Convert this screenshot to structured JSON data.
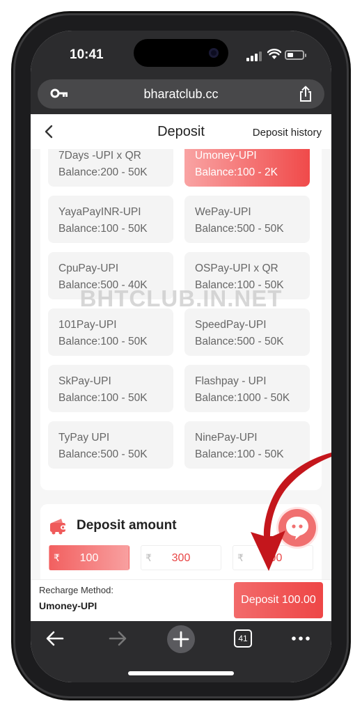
{
  "status": {
    "time": "10:41"
  },
  "browser": {
    "url": "bharatclub.cc",
    "tab_count": "41"
  },
  "header": {
    "title": "Deposit",
    "history": "Deposit history"
  },
  "channels": [
    {
      "name": "7Days -UPI x QR",
      "balance": "Balance:200 - 50K",
      "active": false
    },
    {
      "name": "Umoney-UPI",
      "balance": "Balance:100 - 2K",
      "active": true
    },
    {
      "name": "YayaPayINR-UPI",
      "balance": "Balance:100 - 50K",
      "active": false
    },
    {
      "name": "WePay-UPI",
      "balance": "Balance:500 - 50K",
      "active": false
    },
    {
      "name": "CpuPay-UPI",
      "balance": "Balance:500 - 40K",
      "active": false
    },
    {
      "name": "OSPay-UPI x QR",
      "balance": "Balance:100 - 50K",
      "active": false
    },
    {
      "name": "101Pay-UPI",
      "balance": "Balance:100 - 50K",
      "active": false
    },
    {
      "name": "SpeedPay-UPI",
      "balance": "Balance:500 - 50K",
      "active": false
    },
    {
      "name": "SkPay-UPI",
      "balance": "Balance:100 - 50K",
      "active": false
    },
    {
      "name": "Flashpay - UPI",
      "balance": "Balance:1000 - 50K",
      "active": false
    },
    {
      "name": "TyPay UPI",
      "balance": "Balance:500 - 50K",
      "active": false
    },
    {
      "name": "NinePay-UPI",
      "balance": "Balance:100 - 50K",
      "active": false
    }
  ],
  "watermark": "BHTCLUB.IN.NET",
  "amount": {
    "title": "Deposit amount",
    "currency": "₹",
    "options": [
      "100",
      "300",
      "500"
    ],
    "selected_index": 0
  },
  "footer": {
    "method_label": "Recharge Method:",
    "method_value": "Umoney-UPI",
    "deposit_button": "Deposit 100.00"
  },
  "colors": {
    "accent": "#ee4646",
    "accent_light": "#f9a3a3",
    "arrow": "#c4161c"
  }
}
